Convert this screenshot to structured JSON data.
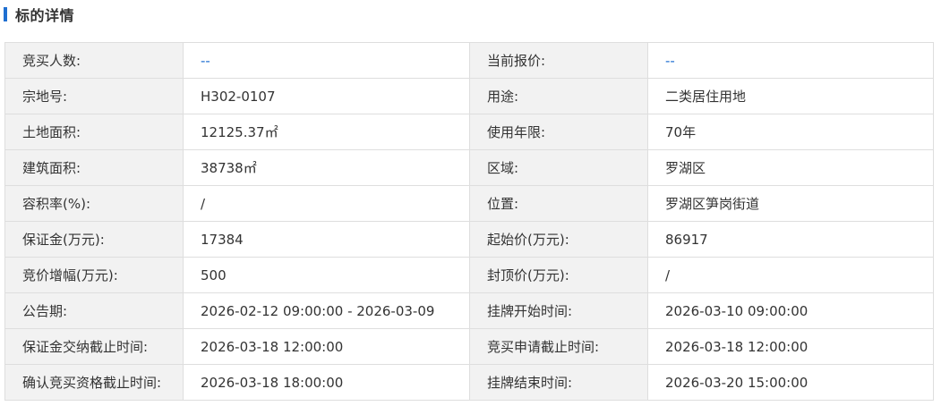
{
  "section": {
    "title": "标的详情",
    "accent_color": "#1f6fd1"
  },
  "rows": [
    {
      "label1": "竞买人数:",
      "value1": "--",
      "label2": "当前报价:",
      "value2": "--"
    },
    {
      "label1": "宗地号:",
      "value1": "H302-0107",
      "label2": "用途:",
      "value2": "二类居住用地"
    },
    {
      "label1": "土地面积:",
      "value1": "12125.37㎡",
      "label2": "使用年限:",
      "value2": "70年"
    },
    {
      "label1": "建筑面积:",
      "value1": "38738㎡",
      "label2": "区域:",
      "value2": "罗湖区"
    },
    {
      "label1": "容积率(%):",
      "value1": "/",
      "label2": "位置:",
      "value2": "罗湖区笋岗街道"
    },
    {
      "label1": "保证金(万元):",
      "value1": "17384",
      "label2": "起始价(万元):",
      "value2": "86917"
    },
    {
      "label1": "竞价增幅(万元):",
      "value1": "500",
      "label2": "封顶价(万元):",
      "value2": "/"
    },
    {
      "label1": "公告期:",
      "value1": "2026-02-12 09:00:00 - 2026-03-09",
      "label2": "挂牌开始时间:",
      "value2": "2026-03-10 09:00:00"
    },
    {
      "label1": "保证金交纳截止时间:",
      "value1": "2026-03-18 12:00:00",
      "label2": "竞买申请截止时间:",
      "value2": "2026-03-18 12:00:00"
    },
    {
      "label1": "确认竞买资格截止时间:",
      "value1": "2026-03-18 18:00:00",
      "label2": "挂牌结束时间:",
      "value2": "2026-03-20 15:00:00"
    }
  ]
}
